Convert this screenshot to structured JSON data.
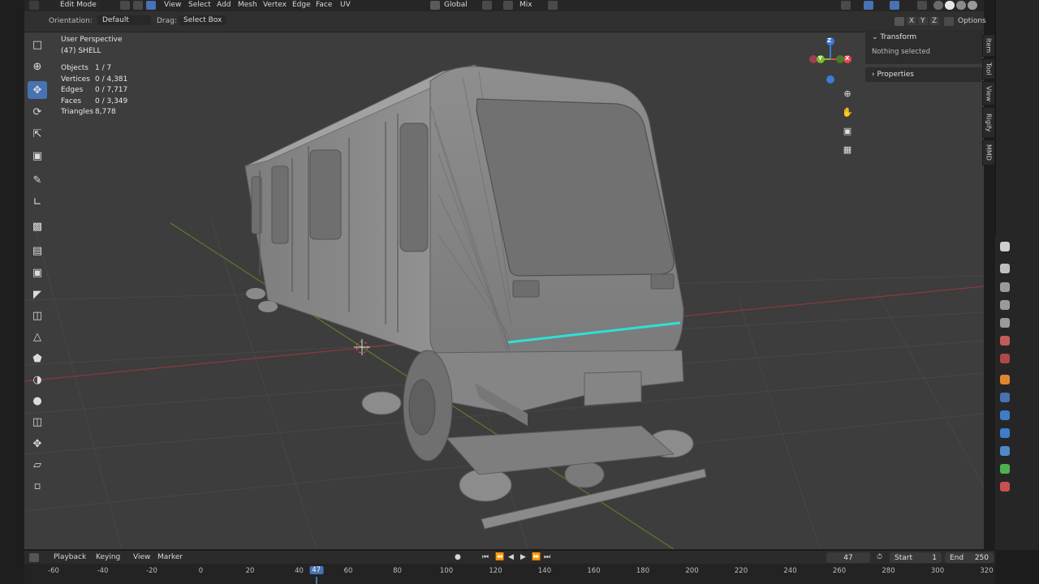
{
  "header": {
    "mode": "Edit Mode",
    "menus": [
      "View",
      "Select",
      "Add",
      "Mesh",
      "Vertex",
      "Edge",
      "Face",
      "UV"
    ],
    "transform_orientation": "Global",
    "pivot_mix": "Mix",
    "orientation_label": "Orientation:",
    "orientation_value": "Default",
    "drag_label": "Drag:",
    "drag_value": "Select Box",
    "axes": [
      "X",
      "Y",
      "Z"
    ],
    "options_label": "Options"
  },
  "viewport": {
    "view_name": "User Perspective",
    "object_label": "(47) SHELL",
    "stats": [
      {
        "key": "Objects",
        "value": "1 / 7"
      },
      {
        "key": "Vertices",
        "value": "0 / 4,381"
      },
      {
        "key": "Edges",
        "value": "0 / 7,717"
      },
      {
        "key": "Faces",
        "value": "0 / 3,349"
      },
      {
        "key": "Triangles",
        "value": "8,778"
      }
    ],
    "gizmo_axes": {
      "z": "Z",
      "y": "Y",
      "x": "X"
    }
  },
  "npanel": {
    "transform_title": "Transform",
    "nothing_selected": "Nothing selected",
    "properties_title": "Properties",
    "tabs": [
      "Item",
      "Tool",
      "View",
      "Rigify",
      "MMD"
    ]
  },
  "timeline": {
    "menus": [
      "Playback",
      "Keying",
      "View",
      "Marker"
    ],
    "current_frame": "47",
    "start_label": "Start",
    "start_value": "1",
    "end_label": "End",
    "end_value": "250",
    "ticks": [
      "-60",
      "-40",
      "-20",
      "0",
      "20",
      "40",
      "60",
      "80",
      "100",
      "120",
      "140",
      "160",
      "180",
      "200",
      "220",
      "240",
      "260",
      "280",
      "300",
      "320"
    ]
  },
  "colors": {
    "accent": "#4772b3",
    "x_axis": "#e0484f",
    "y_axis": "#7dba2e",
    "z_axis": "#3c7bd6",
    "highlight_strip": "#2ee0d8"
  }
}
